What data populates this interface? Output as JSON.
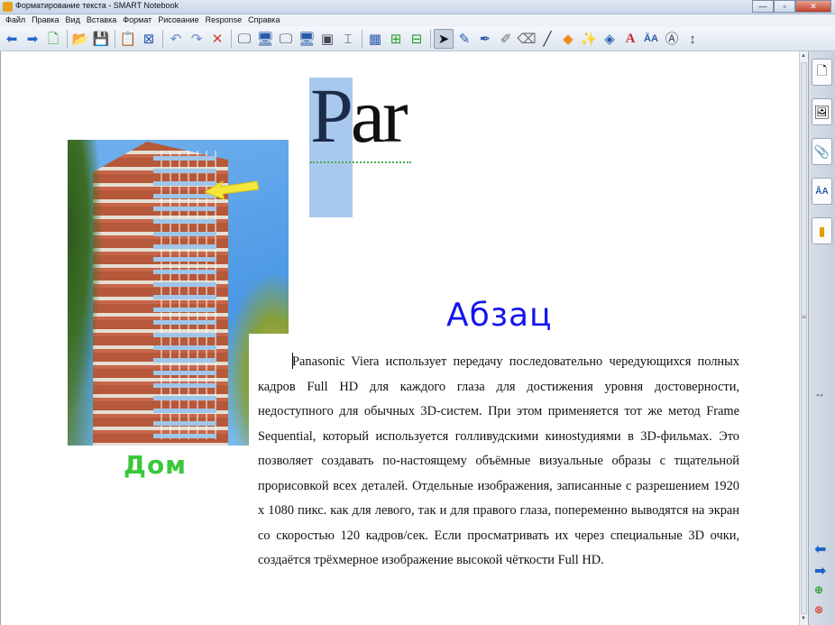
{
  "window": {
    "title": "Форматирование текста - SMART Notebook",
    "controls": [
      "minimize-icon",
      "maximize-icon",
      "close-icon"
    ]
  },
  "menu": [
    "Файл",
    "Правка",
    "Вид",
    "Вставка",
    "Формат",
    "Рисование",
    "Response",
    "Справка"
  ],
  "toolbar": {
    "icons": [
      "back-arrow-icon",
      "forward-arrow-icon",
      "add-page-icon",
      "open-folder-icon",
      "save-icon",
      "paste-icon",
      "delete-page-icon",
      "undo-icon",
      "redo-icon",
      "delete-icon",
      "screen-shade-icon",
      "full-screen-icon",
      "dual-page-icon",
      "spotlight-icon",
      "screen-capture-icon",
      "document-camera-icon",
      "table-icon",
      "insert-icon",
      "attach-icon",
      "select-icon",
      "pen-icon",
      "creative-pen-icon",
      "highlighter-icon",
      "eraser-icon",
      "line-icon",
      "shape-icon",
      "magic-pen-icon",
      "fill-icon",
      "text-icon",
      "properties-icon",
      "measure-icon",
      "more-icon"
    ]
  },
  "sidebar": {
    "tabs": [
      "page-sorter-icon",
      "gallery-icon",
      "attachments-icon",
      "properties-icon",
      "addons-icon"
    ],
    "nav": [
      "previous-page-icon",
      "next-page-icon",
      "add-page-icon",
      "delete-page-icon"
    ]
  },
  "canvas": {
    "heading_word": "Par",
    "heading_first": "P",
    "heading_rest": "ar",
    "image_caption": "Дом",
    "paragraph_title": "Абзац",
    "paragraph_text": "Panasonic Viera использует передачу последовательно чередующихся полных кадров Full HD для каждого глаза для достижения уровня достоверности, недоступного для обычных 3D-систем. При этом применяется тот же метод Frame Sequential, который используется голливудскими кинostудиями в 3D-фильмах. Это позволяет создавать по-настоящему объёмные визуальные образы с тщательной прорисовкой всех деталей. Отдельные изображения, записанные с разрешением 1920 x 1080 пикс. как для левого, так и для правого глаза, попеременно выводятся на экран со скоростью 120 кадров/сек. Если просматривать их через специальные 3D очки, создаётся трёхмерное изображение высокой чёткости Full HD."
  },
  "colors": {
    "caption_green": "#3cc83c",
    "title_blue": "#1414ee",
    "selection_blue": "#a9c8ee",
    "arrow_yellow": "#f5e63a"
  }
}
